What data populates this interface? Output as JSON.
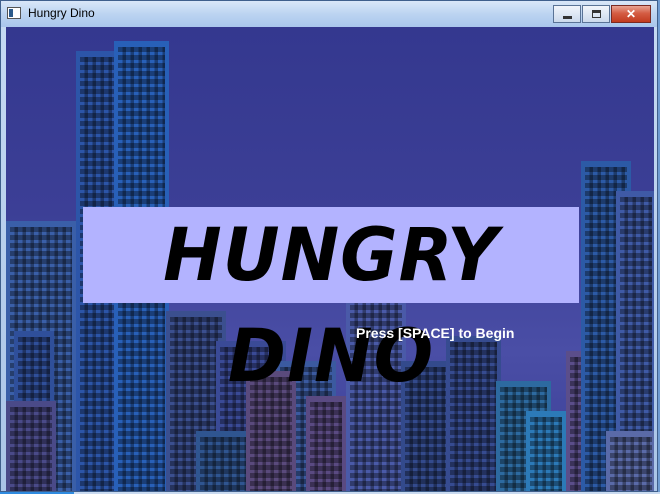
{
  "window": {
    "title": "Hungry Dino",
    "controls": {
      "minimize_icon": "minimize-icon",
      "maximize_icon": "maximize-icon",
      "close_label": "✕"
    }
  },
  "game": {
    "logo_text": "HUNGRY DINO",
    "prompt": "Press [SPACE] to Begin",
    "colors": {
      "sky_top": "#34388f",
      "sky_mid": "#4a4ea6",
      "banner": "#b3b3ff",
      "logo": "#000000",
      "prompt": "#ffffff"
    }
  }
}
